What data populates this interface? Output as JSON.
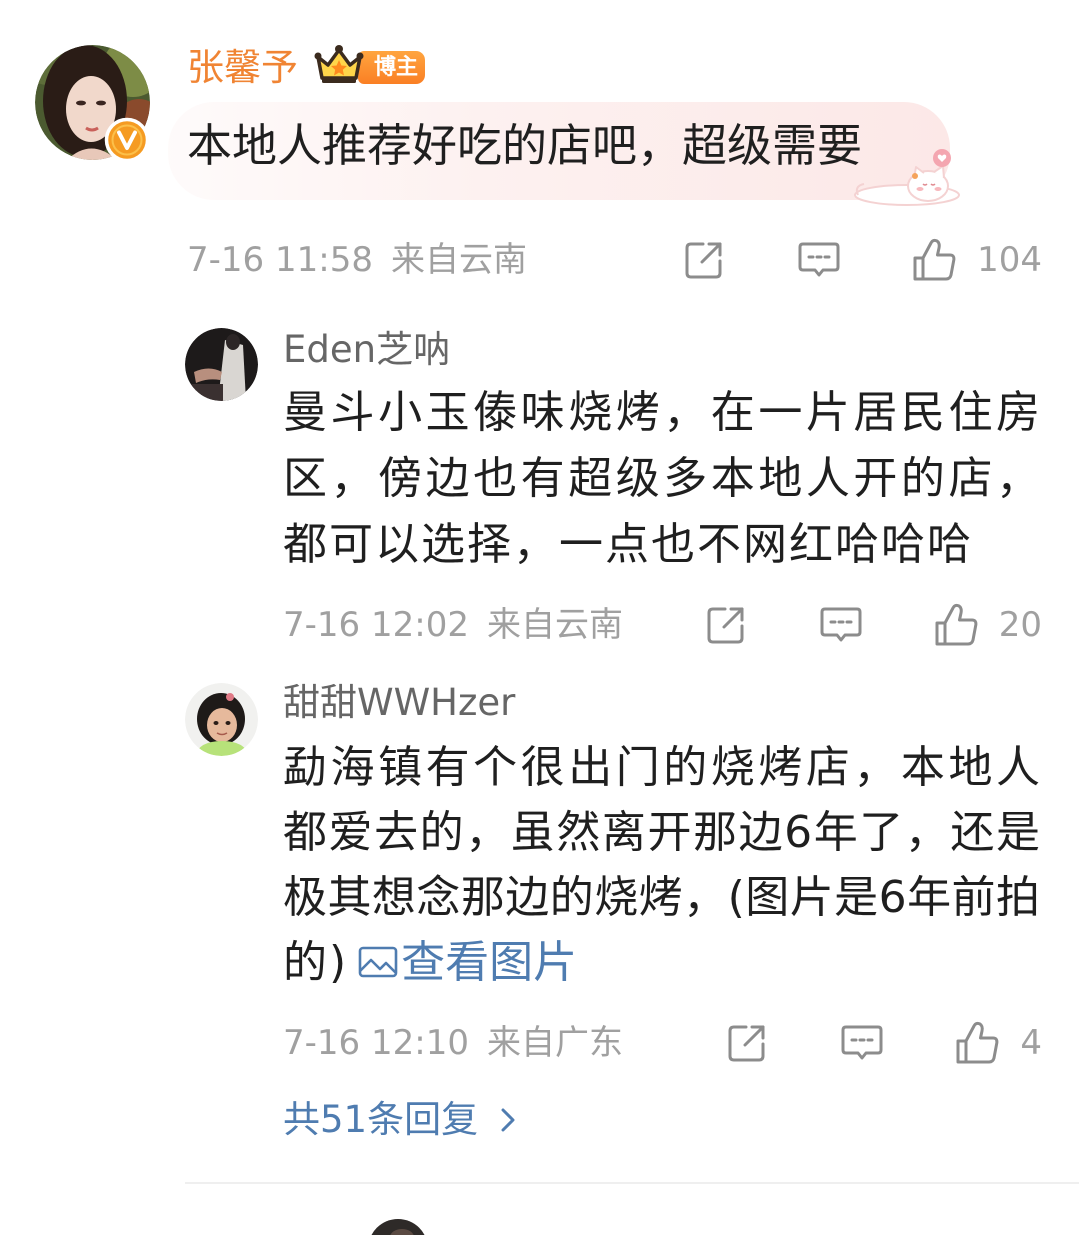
{
  "colors": {
    "vip_name": "#f08433",
    "badge": "#fa7f24",
    "verified": "#f59b22",
    "link": "#4f7cb0",
    "meta": "#a0a0a0",
    "icon": "#8c8c8c",
    "reply_name": "#666666",
    "text": "#1f1f1f"
  },
  "main_comment": {
    "author": "张馨予",
    "avatar_icon": "avatar-photo",
    "verified_icon": "verified-v-icon",
    "crown_icon": "crown-icon",
    "role_badge": "博主",
    "text": "本地人推荐好吃的店吧，超级需要",
    "sticker_icon": "cat-heart-sticker-icon",
    "time": "7-16 11:58",
    "location": "来自云南",
    "actions": {
      "share_icon": "share-icon",
      "comment_icon": "comment-icon",
      "like_icon": "like-icon",
      "likes": "104"
    }
  },
  "replies": [
    {
      "author": "Eden芝呐",
      "avatar_icon": "avatar-photo",
      "text_lines": [
        "曼斗小玉傣味烧烤，在一片居民住房",
        "区，傍边也有超级多本地人开的店，",
        "都可以选择，一点也不网红哈哈哈"
      ],
      "time": "7-16 12:02",
      "location": "来自云南",
      "actions": {
        "share_icon": "share-icon",
        "comment_icon": "comment-icon",
        "like_icon": "like-icon",
        "likes": "20"
      }
    },
    {
      "author": "甜甜WWHzer",
      "avatar_icon": "avatar-photo",
      "text_lines": [
        "勐海镇有个很出门的烧烤店，本地人",
        "都爱去的，虽然离开那边6年了，还是",
        "极其想念那边的烧烤，(图片是6年前拍",
        "的)"
      ],
      "link": {
        "icon": "image-icon",
        "label": "查看图片"
      },
      "time": "7-16 12:10",
      "location": "来自广东",
      "actions": {
        "share_icon": "share-icon",
        "comment_icon": "comment-icon",
        "like_icon": "like-icon",
        "likes": "4"
      }
    }
  ],
  "more_replies": {
    "label": "共51条回复",
    "icon": "chevron-right-icon"
  }
}
